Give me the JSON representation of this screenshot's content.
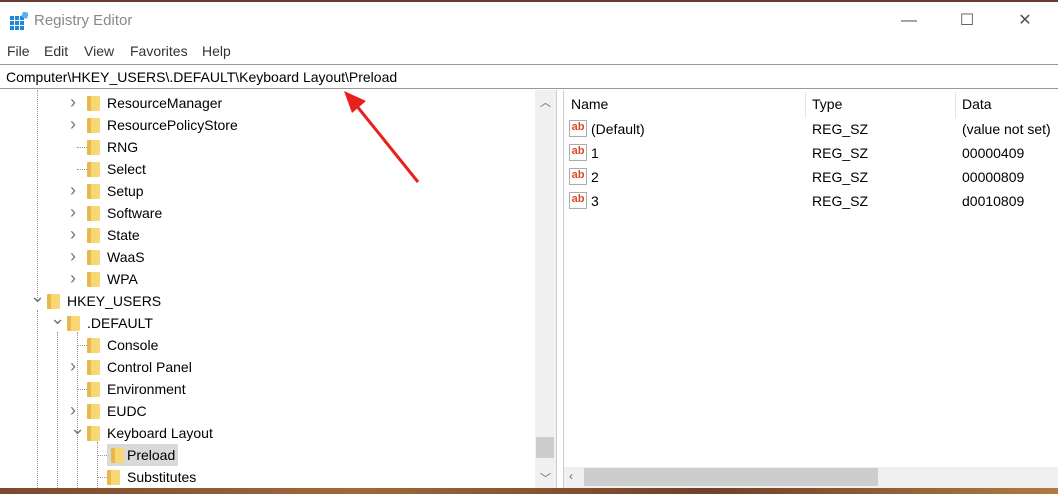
{
  "window": {
    "title": "Registry Editor",
    "minimize": "—",
    "maximize": "☐",
    "close": "✕"
  },
  "menu": [
    "File",
    "Edit",
    "View",
    "Favorites",
    "Help"
  ],
  "address": "Computer\\HKEY_USERS\\.DEFAULT\\Keyboard Layout\\Preload",
  "tree": [
    {
      "label": "ResourceManager",
      "level": 3,
      "exp": "closed"
    },
    {
      "label": "ResourcePolicyStore",
      "level": 3,
      "exp": "closed"
    },
    {
      "label": "RNG",
      "level": 3,
      "exp": "none"
    },
    {
      "label": "Select",
      "level": 3,
      "exp": "none"
    },
    {
      "label": "Setup",
      "level": 3,
      "exp": "closed"
    },
    {
      "label": "Software",
      "level": 3,
      "exp": "closed"
    },
    {
      "label": "State",
      "level": 3,
      "exp": "closed"
    },
    {
      "label": "WaaS",
      "level": 3,
      "exp": "closed"
    },
    {
      "label": "WPA",
      "level": 3,
      "exp": "closed"
    },
    {
      "label": "HKEY_USERS",
      "level": 1,
      "exp": "open"
    },
    {
      "label": ".DEFAULT",
      "level": 2,
      "exp": "open"
    },
    {
      "label": "Console",
      "level": 3,
      "exp": "none"
    },
    {
      "label": "Control Panel",
      "level": 3,
      "exp": "closed"
    },
    {
      "label": "Environment",
      "level": 3,
      "exp": "none"
    },
    {
      "label": "EUDC",
      "level": 3,
      "exp": "closed"
    },
    {
      "label": "Keyboard Layout",
      "level": 3,
      "exp": "open"
    },
    {
      "label": "Preload",
      "level": 4,
      "exp": "none",
      "selected": true
    },
    {
      "label": "Substitutes",
      "level": 4,
      "exp": "none"
    }
  ],
  "list": {
    "headers": [
      "Name",
      "Type",
      "Data"
    ],
    "rows": [
      {
        "name": "(Default)",
        "type": "REG_SZ",
        "data": "(value not set)"
      },
      {
        "name": "1",
        "type": "REG_SZ",
        "data": "00000409"
      },
      {
        "name": "2",
        "type": "REG_SZ",
        "data": "00000809"
      },
      {
        "name": "3",
        "type": "REG_SZ",
        "data": "d0010809"
      }
    ],
    "value_icon": "ab"
  },
  "annotation": {
    "color": "#e8201c"
  }
}
